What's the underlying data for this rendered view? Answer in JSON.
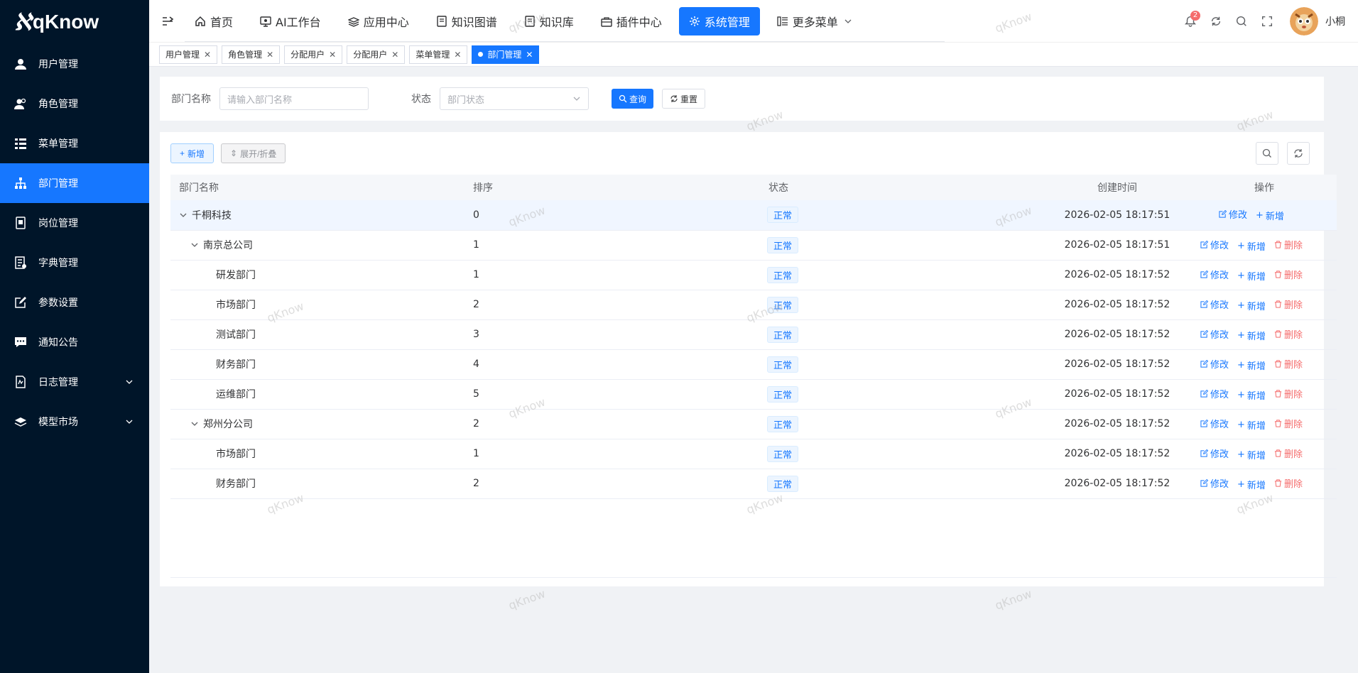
{
  "app": {
    "logo_text": "qKnow"
  },
  "sidebar": {
    "items": [
      {
        "label": "用户管理",
        "icon": "user-icon"
      },
      {
        "label": "角色管理",
        "icon": "users-icon"
      },
      {
        "label": "菜单管理",
        "icon": "menu-icon"
      },
      {
        "label": "部门管理",
        "icon": "tree-icon",
        "active": true
      },
      {
        "label": "岗位管理",
        "icon": "post-icon"
      },
      {
        "label": "字典管理",
        "icon": "dict-icon"
      },
      {
        "label": "参数设置",
        "icon": "edit-icon"
      },
      {
        "label": "通知公告",
        "icon": "message-icon"
      },
      {
        "label": "日志管理",
        "icon": "log-icon",
        "expandable": true
      },
      {
        "label": "模型市场",
        "icon": "model-icon",
        "expandable": true
      }
    ]
  },
  "header": {
    "nav": [
      {
        "label": "首页",
        "icon": "home-icon"
      },
      {
        "label": "AI工作台",
        "icon": "monitor-icon"
      },
      {
        "label": "应用中心",
        "icon": "stack-icon"
      },
      {
        "label": "知识图谱",
        "icon": "doc-icon"
      },
      {
        "label": "知识库",
        "icon": "doc-icon"
      },
      {
        "label": "插件中心",
        "icon": "bag-icon"
      },
      {
        "label": "系统管理",
        "icon": "gear-icon",
        "active": true
      },
      {
        "label": "更多菜单",
        "icon": "grid-icon"
      }
    ],
    "notification_count": "2",
    "username": "小桐"
  },
  "tags": [
    {
      "label": "用户管理"
    },
    {
      "label": "角色管理"
    },
    {
      "label": "分配用户"
    },
    {
      "label": "分配用户"
    },
    {
      "label": "菜单管理"
    },
    {
      "label": "部门管理",
      "active": true
    }
  ],
  "search": {
    "dept_label": "部门名称",
    "dept_placeholder": "请输入部门名称",
    "status_label": "状态",
    "status_placeholder": "部门状态",
    "query_btn": "查询",
    "reset_btn": "重置"
  },
  "toolbar": {
    "add_btn": "新增",
    "toggle_btn": "展开/折叠"
  },
  "table": {
    "headers": {
      "name": "部门名称",
      "order": "排序",
      "status": "状态",
      "created": "创建时间",
      "ops": "操作"
    },
    "ops": {
      "edit": "修改",
      "add": "新增",
      "delete": "删除"
    },
    "rows": [
      {
        "name": "千桐科技",
        "order": "0",
        "status": "正常",
        "created": "2026-02-05 18:17:51",
        "level": 0,
        "expandable": true,
        "can_delete": false
      },
      {
        "name": "南京总公司",
        "order": "1",
        "status": "正常",
        "created": "2026-02-05 18:17:51",
        "level": 1,
        "expandable": true,
        "can_delete": true
      },
      {
        "name": "研发部门",
        "order": "1",
        "status": "正常",
        "created": "2026-02-05 18:17:52",
        "level": 2,
        "expandable": false,
        "can_delete": true
      },
      {
        "name": "市场部门",
        "order": "2",
        "status": "正常",
        "created": "2026-02-05 18:17:52",
        "level": 2,
        "expandable": false,
        "can_delete": true
      },
      {
        "name": "测试部门",
        "order": "3",
        "status": "正常",
        "created": "2026-02-05 18:17:52",
        "level": 2,
        "expandable": false,
        "can_delete": true
      },
      {
        "name": "财务部门",
        "order": "4",
        "status": "正常",
        "created": "2026-02-05 18:17:52",
        "level": 2,
        "expandable": false,
        "can_delete": true
      },
      {
        "name": "运维部门",
        "order": "5",
        "status": "正常",
        "created": "2026-02-05 18:17:52",
        "level": 2,
        "expandable": false,
        "can_delete": true
      },
      {
        "name": "郑州分公司",
        "order": "2",
        "status": "正常",
        "created": "2026-02-05 18:17:52",
        "level": 1,
        "expandable": true,
        "can_delete": true
      },
      {
        "name": "市场部门",
        "order": "1",
        "status": "正常",
        "created": "2026-02-05 18:17:52",
        "level": 2,
        "expandable": false,
        "can_delete": true
      },
      {
        "name": "财务部门",
        "order": "2",
        "status": "正常",
        "created": "2026-02-05 18:17:52",
        "level": 2,
        "expandable": false,
        "can_delete": true
      }
    ]
  },
  "watermark": "qKnow",
  "colors": {
    "primary": "#1677ff",
    "sidebar_bg": "#001529",
    "danger": "#f56c6c"
  }
}
